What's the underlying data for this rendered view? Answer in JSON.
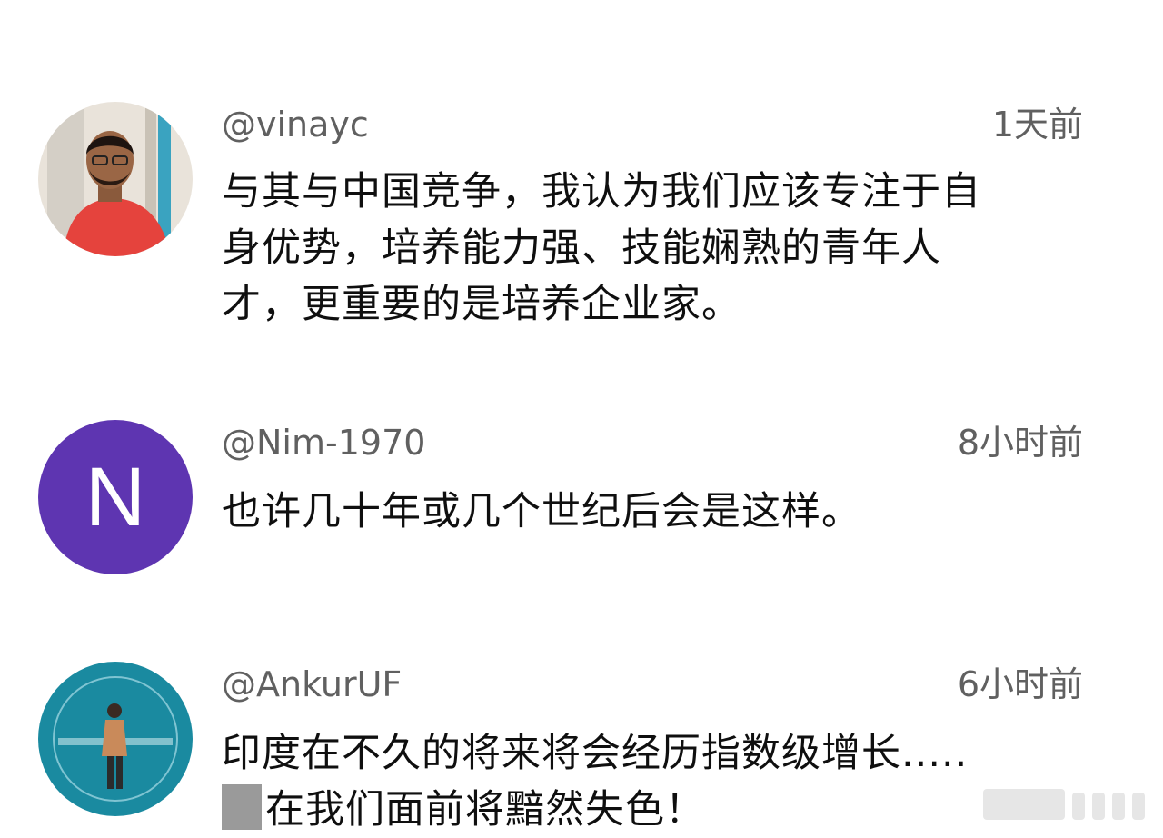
{
  "comments": [
    {
      "username": "@vinayc",
      "time": "1天前",
      "lines": [
        "与其与中国竞争，我认为我们应该专注于自",
        "身优势，培养能力强、技能娴熟的青年人",
        "才，更重要的是培养企业家。"
      ],
      "avatar_type": "photo"
    },
    {
      "username": "@Nim-1970",
      "time": "8小时前",
      "lines": [
        "也许几十年或几个世纪后会是这样。"
      ],
      "avatar_type": "letter",
      "avatar_letter": "N",
      "avatar_color": "#5e35b1"
    },
    {
      "username": "@AnkurUF",
      "time": "6小时前",
      "lines": [
        "印度在不久的将来将会经历指数级增长.....",
        "在我们面前将黯然失色！"
      ],
      "avatar_type": "logo",
      "avatar_color": "#1a8aa0"
    }
  ],
  "colors": {
    "meta_text": "#606060",
    "body_text": "#0f0f0f"
  }
}
